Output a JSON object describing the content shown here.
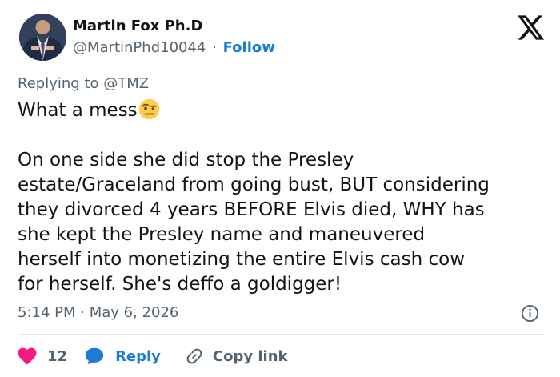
{
  "author": {
    "name": "Martin Fox Ph.D",
    "handle": "@MartinPhd10044",
    "separator": "·",
    "follow_label": "Follow"
  },
  "reply_context": {
    "prefix": "Replying to",
    "mention": "@TMZ"
  },
  "tweet": {
    "first_line": "What a mess",
    "emoji": "face-with-raised-eyebrow",
    "lines": [
      "On one side she did stop the Presley",
      "estate/Graceland from going bust, BUT considering",
      "they divorced 4 years BEFORE Elvis died, WHY has",
      "she kept the Presley name and maneuvered",
      "herself into monetizing the entire Elvis cash cow",
      "for herself. She's deffo a goldigger!"
    ],
    "time": "5:14 PM",
    "separator": "·",
    "date": "May 6, 2026"
  },
  "actions": {
    "like_count": "12",
    "reply_label": "Reply",
    "copy_label": "Copy link"
  },
  "icons": {
    "logo": "x-logo-icon",
    "info": "info-icon",
    "like": "heart-icon",
    "reply": "speech-bubble-icon",
    "copy": "link-icon"
  },
  "colors": {
    "accent": "#1d7bd6",
    "like": "#f91880",
    "secondary_text": "#536471",
    "primary_text": "#0f1419"
  }
}
